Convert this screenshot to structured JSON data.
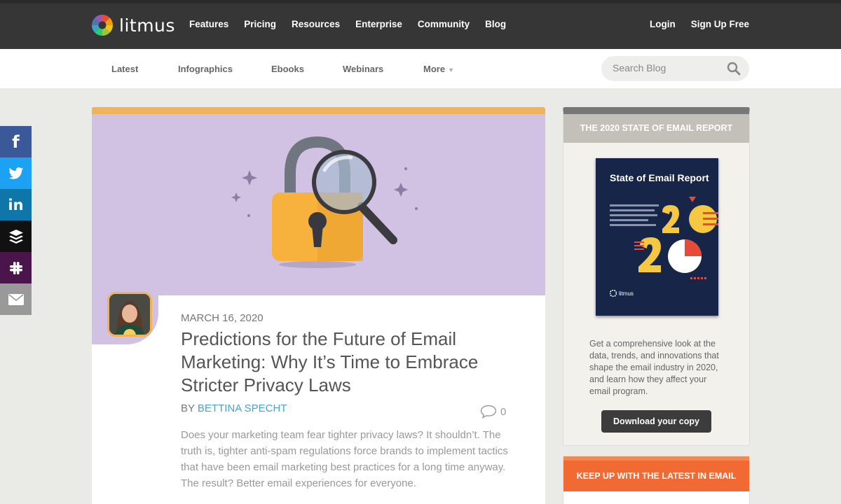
{
  "header": {
    "logo_text": "litmus",
    "nav": [
      "Features",
      "Pricing",
      "Resources",
      "Enterprise",
      "Community",
      "Blog"
    ],
    "login": "Login",
    "signup": "Sign Up Free"
  },
  "subnav": {
    "items": [
      "Latest",
      "Infographics",
      "Ebooks",
      "Webinars"
    ],
    "more": "More",
    "search_placeholder": "Search Blog"
  },
  "social": {
    "icons": [
      "facebook-icon",
      "twitter-icon",
      "linkedin-icon",
      "buffer-icon",
      "slack-icon",
      "email-icon"
    ],
    "colors": [
      "#3b5998",
      "#1da1f2",
      "#0e76a8",
      "#111111",
      "#4a154b",
      "#999999"
    ]
  },
  "article": {
    "date": "MARCH 16, 2020",
    "title": "Predictions for the Future of Email Marketing: Why It’s Time to Embrace Stricter Privacy Laws",
    "by": "BY",
    "author": "BETTINA SPECHT",
    "comment_count": "0",
    "excerpt": "Does your marketing team fear tighter privacy laws? It shouldn’t. The truth is, tighter anti-spam regulations force brands to implement tactics that have been email marketing best practices for a long time anyway. The result? Better email experiences for everyone.",
    "accent_color": "#f0b35a",
    "hero_color": "#d1c1e3"
  },
  "sidebar": {
    "report_heading": "THE 2020 STATE OF EMAIL REPORT",
    "book_title": "State of Email Report",
    "book_logo": "litmus",
    "report_description": "Get a comprehensive look at the data, trends, and innovations that shape the email industry in 2020, and learn how they affect your email program.",
    "download_button": "Download your copy",
    "newsletter_heading": "KEEP UP WITH THE LATEST IN EMAIL"
  }
}
